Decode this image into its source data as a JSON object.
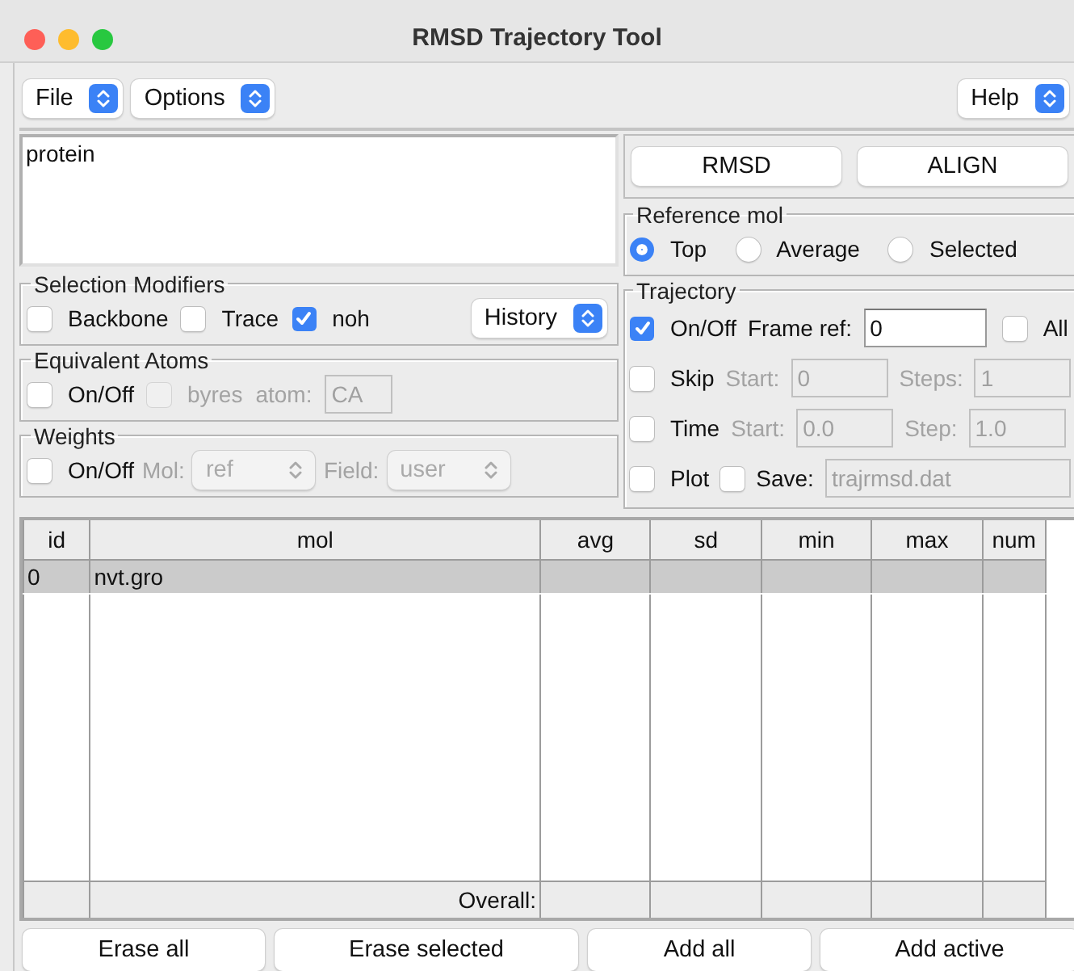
{
  "window": {
    "title": "RMSD Trajectory Tool"
  },
  "menus": [
    {
      "label": "File"
    },
    {
      "label": "Options"
    }
  ],
  "help_menu": {
    "label": "Help"
  },
  "left_panel": {
    "selection": "protein",
    "groups": [
      {
        "title": "Selection Modifiers",
        "rows": [
          {
            "items": [
              {
                "kind": "checkbox",
                "label": "Backbone",
                "checked": false,
                "disabled": false
              },
              {
                "kind": "checkbox",
                "label": "Trace",
                "checked": false,
                "disabled": false
              },
              {
                "kind": "checkbox",
                "label": "noh",
                "checked": true,
                "disabled": false
              },
              {
                "kind": "select",
                "label": "History",
                "disabled": false
              }
            ]
          }
        ]
      },
      {
        "title": "Equivalent Atoms",
        "rows": [
          {
            "items": [
              {
                "kind": "checkbox",
                "label": "On/Off",
                "checked": false,
                "disabled": false
              },
              {
                "kind": "checkbox",
                "label": "byres",
                "checked": false,
                "disabled": true
              },
              {
                "kind": "label",
                "text": "atom:",
                "disabled": true
              },
              {
                "kind": "field",
                "value": "CA",
                "disabled": true
              }
            ]
          }
        ]
      },
      {
        "title": "Weights",
        "rows": [
          {
            "items": [
              {
                "kind": "checkbox",
                "label": "On/Off",
                "checked": false,
                "disabled": false
              },
              {
                "kind": "label",
                "text": "Mol:",
                "disabled": true
              },
              {
                "kind": "select",
                "label": "ref",
                "disabled": true
              },
              {
                "kind": "label",
                "text": "Field:",
                "disabled": true
              },
              {
                "kind": "select",
                "label": "user",
                "disabled": true
              }
            ]
          }
        ]
      }
    ]
  },
  "right_panel": {
    "actions": [
      "RMSD",
      "ALIGN"
    ],
    "groups": [
      {
        "title": "Reference mol",
        "rows": [
          {
            "items": [
              {
                "kind": "radio",
                "label": "Top",
                "selected": true
              },
              {
                "kind": "radio",
                "label": "Average",
                "selected": false
              },
              {
                "kind": "radio",
                "label": "Selected",
                "selected": false
              }
            ]
          }
        ]
      },
      {
        "title": "Trajectory",
        "rows": [
          {
            "items": [
              {
                "kind": "checkbox",
                "label": "On/Off",
                "checked": true,
                "disabled": false
              },
              {
                "kind": "label",
                "text": "Frame ref:",
                "disabled": false
              },
              {
                "kind": "field",
                "value": "0",
                "disabled": false
              },
              {
                "kind": "checkbox",
                "label": "All",
                "checked": false,
                "disabled": false
              }
            ]
          },
          {
            "items": [
              {
                "kind": "checkbox",
                "label": "Skip",
                "checked": false,
                "disabled": false
              },
              {
                "kind": "label",
                "text": "Start:",
                "disabled": true
              },
              {
                "kind": "field",
                "value": "0",
                "disabled": true
              },
              {
                "kind": "label",
                "text": "Steps:",
                "disabled": true
              },
              {
                "kind": "field",
                "value": "1",
                "disabled": true
              }
            ]
          },
          {
            "items": [
              {
                "kind": "checkbox",
                "label": "Time",
                "checked": false,
                "disabled": false
              },
              {
                "kind": "label",
                "text": "Start:",
                "disabled": true
              },
              {
                "kind": "field",
                "value": "0.0",
                "disabled": true
              },
              {
                "kind": "label",
                "text": "Step:",
                "disabled": true
              },
              {
                "kind": "field",
                "value": "1.0",
                "disabled": true
              }
            ]
          },
          {
            "items": [
              {
                "kind": "checkbox",
                "label": "Plot",
                "checked": false,
                "disabled": false
              },
              {
                "kind": "checkbox",
                "checked": false,
                "disabled": false
              },
              {
                "kind": "label",
                "text": "Save:",
                "disabled": false
              },
              {
                "kind": "field",
                "value": "trajrmsd.dat",
                "disabled": true
              }
            ]
          }
        ]
      }
    ]
  },
  "table": {
    "columns": [
      "id",
      "mol",
      "avg",
      "sd",
      "min",
      "max",
      "num"
    ],
    "rows": [
      {
        "id": "0",
        "mol": "nvt.gro",
        "selected": true
      }
    ],
    "footer": "Overall:"
  },
  "buttons": [
    "Erase all",
    "Erase selected",
    "Add all",
    "Add active"
  ]
}
